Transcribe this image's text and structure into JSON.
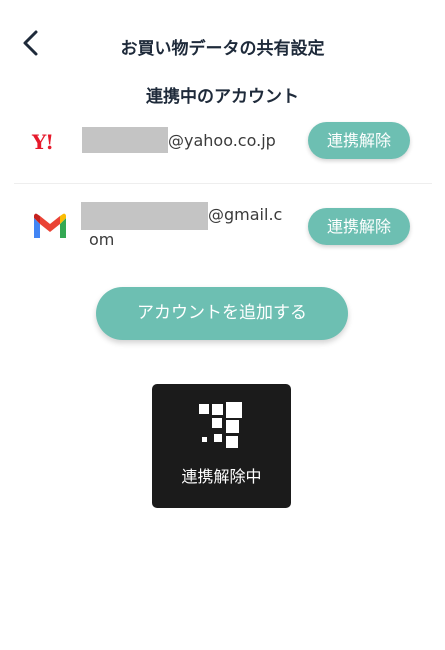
{
  "header": {
    "back_icon": "chevron-left-icon",
    "title": "お買い物データの共有設定"
  },
  "linked_accounts": {
    "title": "連携中のアカウント",
    "accounts": [
      {
        "provider": "Yahoo! JAPAN",
        "logo_text": "Y!",
        "email_visible_part": "@yahoo.co.jp",
        "email_line2": "",
        "unlink_label": "連携解除"
      },
      {
        "provider": "Gmail",
        "logo_icon": "gmail-icon",
        "email_visible_part": "@gmail.c",
        "email_line2": "om",
        "unlink_label": "連携解除"
      }
    ]
  },
  "add_account_label": "アカウントを追加する",
  "toast": {
    "icon": "loading-spinner-icon",
    "message": "連携解除中"
  },
  "colors": {
    "accent": "#6dbfb2",
    "text_dark": "#1e2a3a",
    "yahoo_red": "#e6192b",
    "toast_bg": "#1b1b1b",
    "masked": "#c4c4c4"
  }
}
